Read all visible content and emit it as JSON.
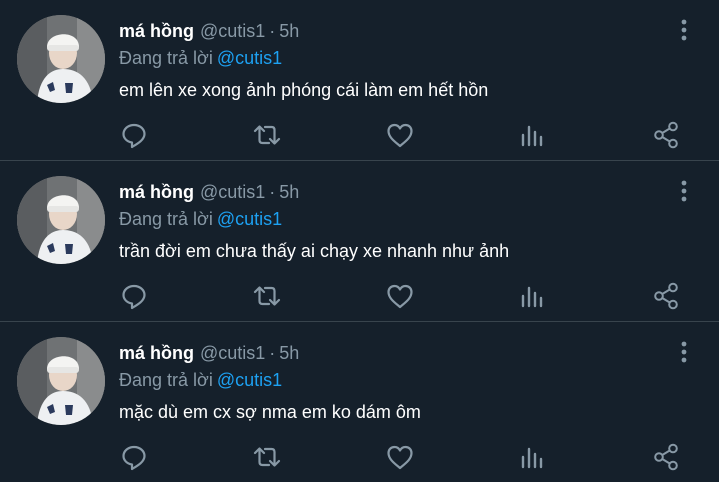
{
  "colors": {
    "background": "#15202b",
    "divider": "#38444d",
    "text_primary": "#ffffff",
    "text_secondary": "#8899a6",
    "link": "#1da1f2"
  },
  "tweets": [
    {
      "name": "má hồng",
      "handle": "@cutis1",
      "separator": "·",
      "time": "5h",
      "reply_prefix": "Đang trả lời",
      "reply_to": "@cutis1",
      "text": "em lên xe xong ảnh phóng cái làm em hết hồn",
      "avatar_icon": "profile-photo",
      "actions": [
        "reply-icon",
        "retweet-icon",
        "like-icon",
        "analytics-icon",
        "share-icon"
      ],
      "more_icon": "more-vertical-icon"
    },
    {
      "name": "má hồng",
      "handle": "@cutis1",
      "separator": "·",
      "time": "5h",
      "reply_prefix": "Đang trả lời",
      "reply_to": "@cutis1",
      "text": "trần đời em chưa thấy ai chạy xe nhanh như ảnh",
      "avatar_icon": "profile-photo",
      "actions": [
        "reply-icon",
        "retweet-icon",
        "like-icon",
        "analytics-icon",
        "share-icon"
      ],
      "more_icon": "more-vertical-icon"
    },
    {
      "name": "má hồng",
      "handle": "@cutis1",
      "separator": "·",
      "time": "5h",
      "reply_prefix": "Đang trả lời",
      "reply_to": "@cutis1",
      "text": "mặc dù em cx sợ nma em ko dám ôm",
      "avatar_icon": "profile-photo",
      "actions": [
        "reply-icon",
        "retweet-icon",
        "like-icon",
        "analytics-icon",
        "share-icon"
      ],
      "more_icon": "more-vertical-icon"
    }
  ]
}
